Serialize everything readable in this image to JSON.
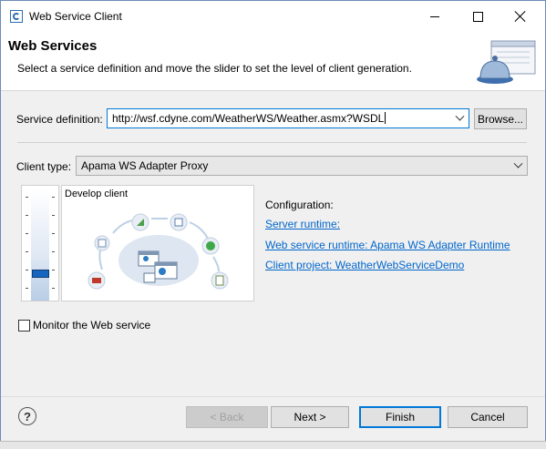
{
  "window": {
    "title": "Web Service Client"
  },
  "header": {
    "title": "Web Services",
    "description": "Select a service definition and move the slider to set the level of client generation.",
    "icon": "web-service-bell-icon"
  },
  "service_definition": {
    "label": "Service definition:",
    "value": "http://wsf.cdyne.com/WeatherWS/Weather.asmx?WSDL",
    "browse_label": "Browse..."
  },
  "client_type": {
    "label": "Client type:",
    "value": "Apama WS Adapter Proxy"
  },
  "slider": {
    "level_caption": "Develop client",
    "level_index": 1,
    "level_count": 6
  },
  "configuration": {
    "title": "Configuration:",
    "server_runtime": "Server runtime: ",
    "web_service_runtime": "Web service runtime: Apama WS Adapter Runtime",
    "client_project": "Client project: WeatherWebServiceDemo"
  },
  "monitor": {
    "label": "Monitor the Web service",
    "checked": false
  },
  "buttons": {
    "help": "?",
    "back": "< Back",
    "next": "Next >",
    "finish": "Finish",
    "cancel": "Cancel"
  },
  "colors": {
    "link": "#0066cc",
    "focus": "#0078d7",
    "slider_thumb": "#1565c0"
  }
}
